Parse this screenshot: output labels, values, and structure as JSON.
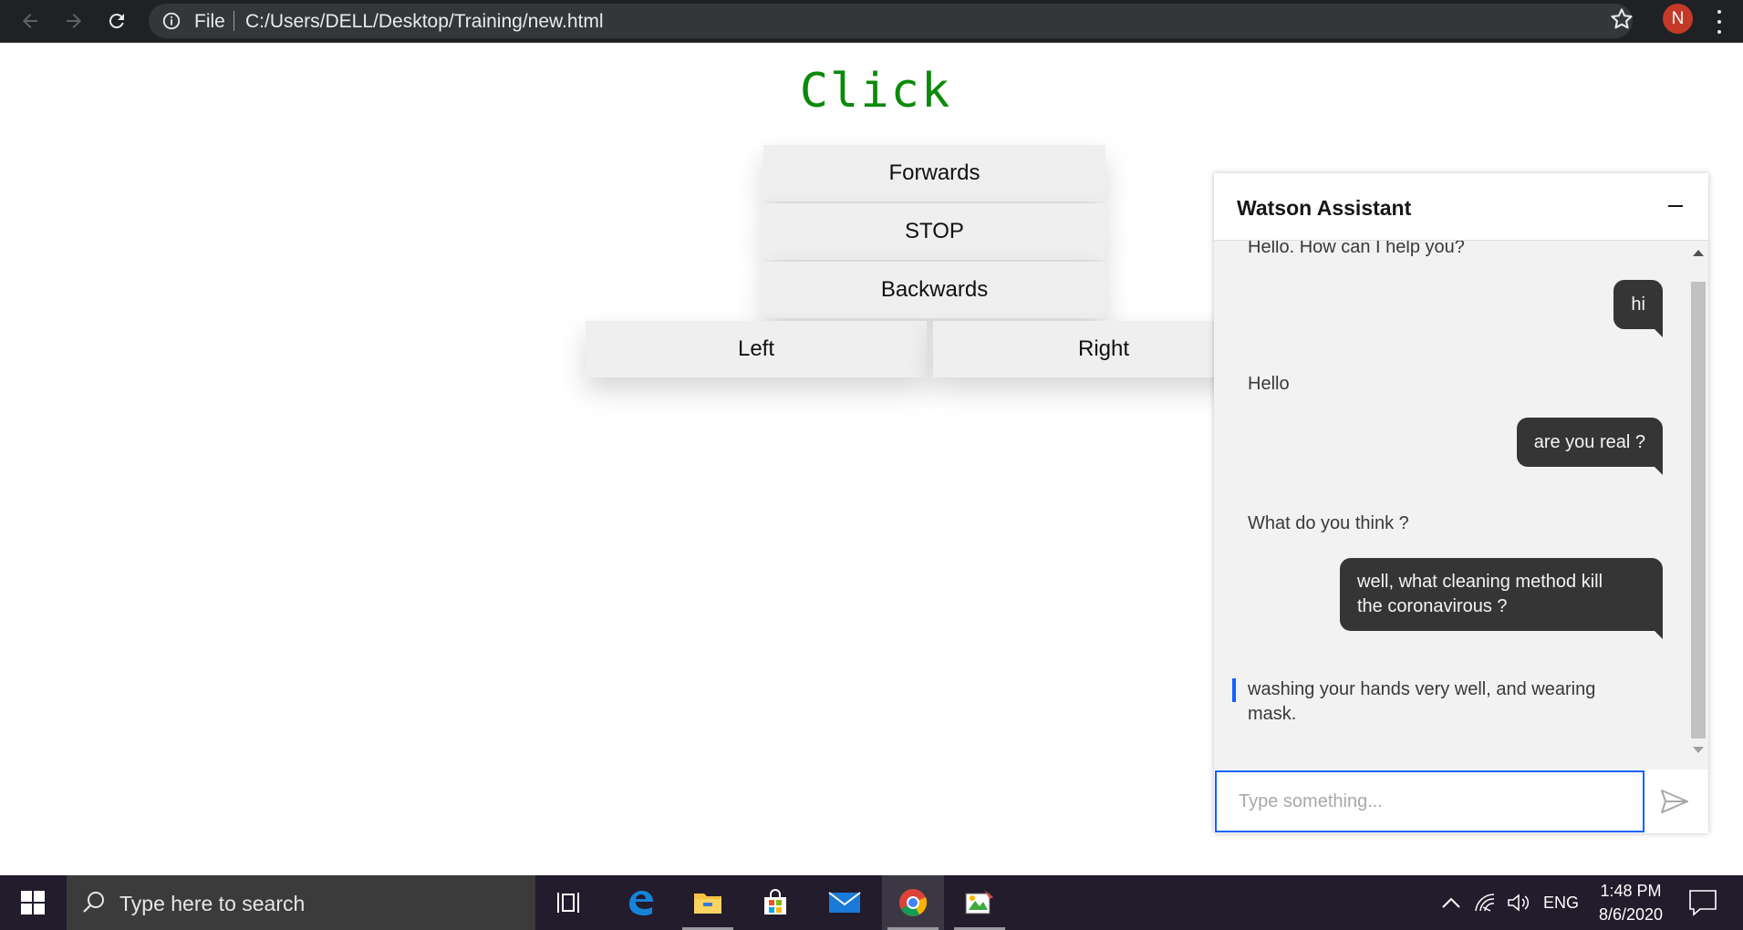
{
  "browser": {
    "file_label": "File",
    "url": "C:/Users/DELL/Desktop/Training/new.html",
    "profile_initial": "N"
  },
  "page": {
    "title": "Click",
    "title_color": "#0a8a0a",
    "buttons": {
      "forwards": "Forwards",
      "stop": "STOP",
      "backwards": "Backwards",
      "left": "Left",
      "right": "Right"
    }
  },
  "watson": {
    "title": "Watson Assistant",
    "accent_color": "#0f62fe",
    "messages": [
      {
        "from": "bot",
        "text": "Hello. How can I help you?"
      },
      {
        "from": "user",
        "text": "hi"
      },
      {
        "from": "bot",
        "text": "Hello"
      },
      {
        "from": "user",
        "text": "are you real ?"
      },
      {
        "from": "bot",
        "text": "What do you think ?"
      },
      {
        "from": "user",
        "text_line1": "well, what cleaning method kill",
        "text_line2": "the coronavirous ?"
      },
      {
        "from": "bot",
        "text_line1": "washing your hands very well, and wearing",
        "text_line2": "mask."
      }
    ],
    "input_placeholder": "Type something..."
  },
  "taskbar": {
    "search_text": "Type here to search",
    "language": "ENG",
    "time": "1:48 PM",
    "date": "8/6/2020",
    "pinned_icons": [
      "task-view-icon",
      "edge-icon",
      "file-explorer-icon",
      "store-icon",
      "mail-icon",
      "chrome-icon",
      "paint-icon"
    ]
  }
}
